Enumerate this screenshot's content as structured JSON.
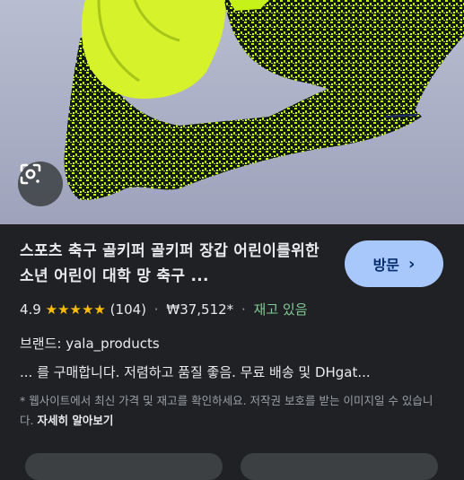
{
  "product": {
    "title": "스포츠 축구 골키퍼 골키퍼 장갑 어린이를위한 소년 어린이 대학 망 축구 ...",
    "rating": "4.9",
    "stars": "★★★★★",
    "review_count": "(104)",
    "price": "₩37,512*",
    "stock": "재고 있음",
    "brand_line": "브랜드: yala_products",
    "description": "... 를 구매합니다. 저렴하고 품질 좋음. 무료 배송 및 DHgat...",
    "disclaimer": "* 웹사이트에서 최신 가격 및 재고를 확인하세요. 저작권 보호를 받는 이미지일 수 있습니다.",
    "learn_more": "자세히 알아보기"
  },
  "visit_button": {
    "label": "방문",
    "icon": "chevron-right-icon"
  },
  "lens_button": {
    "icon": "google-lens-icon"
  },
  "colors": {
    "accent": "#a8c7fa",
    "stars": "#fbbc04",
    "stock": "#81c995",
    "glove": "#c6f219"
  }
}
